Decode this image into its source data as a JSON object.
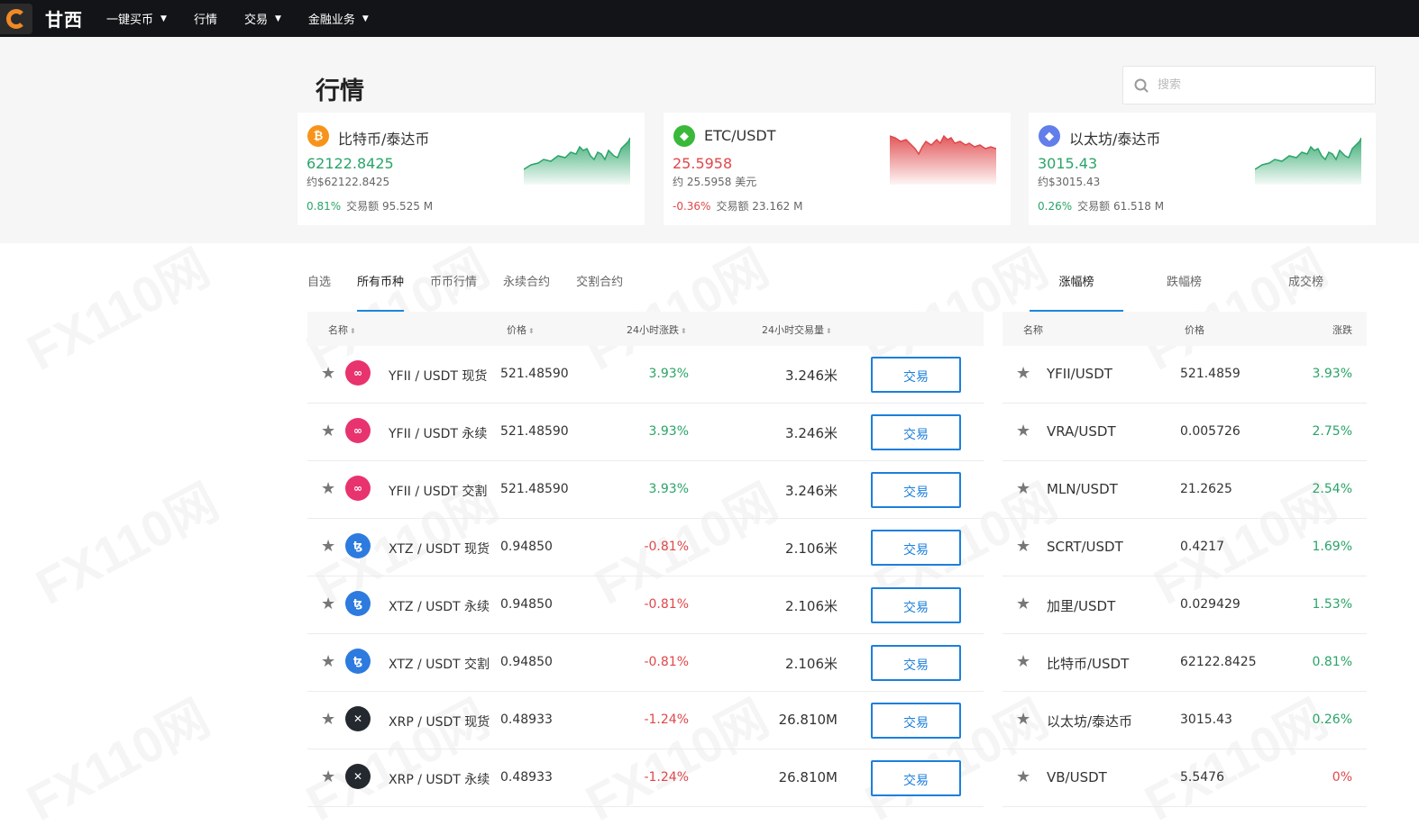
{
  "nav": {
    "brand": "甘西",
    "items": [
      {
        "label": "一键买币",
        "caret": "▼"
      },
      {
        "label": "行情",
        "caret": ""
      },
      {
        "label": "交易",
        "caret": "▼"
      },
      {
        "label": "金融业务",
        "caret": "▼"
      }
    ]
  },
  "page": {
    "title": "行情",
    "search_placeholder": "搜索",
    "watermark": "FX110网"
  },
  "cards": [
    {
      "name": "比特币/泰达币",
      "price": "62122.8425",
      "approx": "约$62122.8425",
      "change": "0.81%",
      "volume": "交易额 95.525 M",
      "trend": "up",
      "icon": "₿",
      "icon_color": "#f7931a"
    },
    {
      "name": "ETC/USDT",
      "price": "25.5958",
      "approx": "约 25.5958 美元",
      "change": "-0.36%",
      "volume": "交易额 23.162 M",
      "trend": "down",
      "icon": "◆",
      "icon_color": "#3ab83a"
    },
    {
      "name": "以太坊/泰达币",
      "price": "3015.43",
      "approx": "约$3015.43",
      "change": "0.26%",
      "volume": "交易额 61.518 M",
      "trend": "up",
      "icon": "◆",
      "icon_color": "#627eea"
    }
  ],
  "tabs": {
    "left": [
      "自选",
      "所有币种",
      "币币行情",
      "永续合约",
      "交割合约"
    ],
    "right": [
      "涨幅榜",
      "跌幅榜",
      "成交榜"
    ]
  },
  "table": {
    "headers": {
      "name": "名称",
      "price": "价格",
      "change": "24小时涨跌",
      "volume": "24小时交易量"
    },
    "sort_glyph": "⬍",
    "trade_label": "交易",
    "rows": [
      {
        "pair": "YFII / USDT 现货",
        "price": "521.48590",
        "change": "3.93%",
        "dir": "up",
        "volume": "3.246米",
        "icon": "yfii"
      },
      {
        "pair": "YFII / USDT 永续",
        "price": "521.48590",
        "change": "3.93%",
        "dir": "up",
        "volume": "3.246米",
        "icon": "yfii"
      },
      {
        "pair": "YFII / USDT 交割",
        "price": "521.48590",
        "change": "3.93%",
        "dir": "up",
        "volume": "3.246米",
        "icon": "yfii"
      },
      {
        "pair": "XTZ / USDT 现货",
        "price": "0.94850",
        "change": "-0.81%",
        "dir": "down",
        "volume": "2.106米",
        "icon": "xtz"
      },
      {
        "pair": "XTZ / USDT 永续",
        "price": "0.94850",
        "change": "-0.81%",
        "dir": "down",
        "volume": "2.106米",
        "icon": "xtz"
      },
      {
        "pair": "XTZ / USDT 交割",
        "price": "0.94850",
        "change": "-0.81%",
        "dir": "down",
        "volume": "2.106米",
        "icon": "xtz"
      },
      {
        "pair": "XRP / USDT 现货",
        "price": "0.48933",
        "change": "-1.24%",
        "dir": "down",
        "volume": "26.810M",
        "icon": "xrp"
      },
      {
        "pair": "XRP / USDT 永续",
        "price": "0.48933",
        "change": "-1.24%",
        "dir": "down",
        "volume": "26.810M",
        "icon": "xrp"
      }
    ]
  },
  "ranking": {
    "headers": {
      "name": "名称",
      "price": "价格",
      "change": "涨跌"
    },
    "rows": [
      {
        "pair": "YFII/USDT",
        "price": "521.4859",
        "change": "3.93%",
        "dir": "up"
      },
      {
        "pair": "VRA/USDT",
        "price": "0.005726",
        "change": "2.75%",
        "dir": "up"
      },
      {
        "pair": "MLN/USDT",
        "price": "21.2625",
        "change": "2.54%",
        "dir": "up"
      },
      {
        "pair": "SCRT/USDT",
        "price": "0.4217",
        "change": "1.69%",
        "dir": "up"
      },
      {
        "pair": "加里/USDT",
        "price": "0.029429",
        "change": "1.53%",
        "dir": "up"
      },
      {
        "pair": "比特币/USDT",
        "price": "62122.8425",
        "change": "0.81%",
        "dir": "up"
      },
      {
        "pair": "以太坊/泰达币",
        "price": "3015.43",
        "change": "0.26%",
        "dir": "up"
      },
      {
        "pair": "VB/USDT",
        "price": "5.5476",
        "change": "0%",
        "dir": "down"
      }
    ]
  },
  "colors": {
    "up": "#2aa468",
    "down": "#e0474a",
    "accent": "#1c86dc",
    "yfii": "#e8336f",
    "xtz": "#2d7bde",
    "xrp": "#23292f"
  },
  "icons": {
    "star": "★",
    "search": "search-icon",
    "yfii": "∞",
    "xtz": "ꜩ",
    "xrp": "✕"
  }
}
